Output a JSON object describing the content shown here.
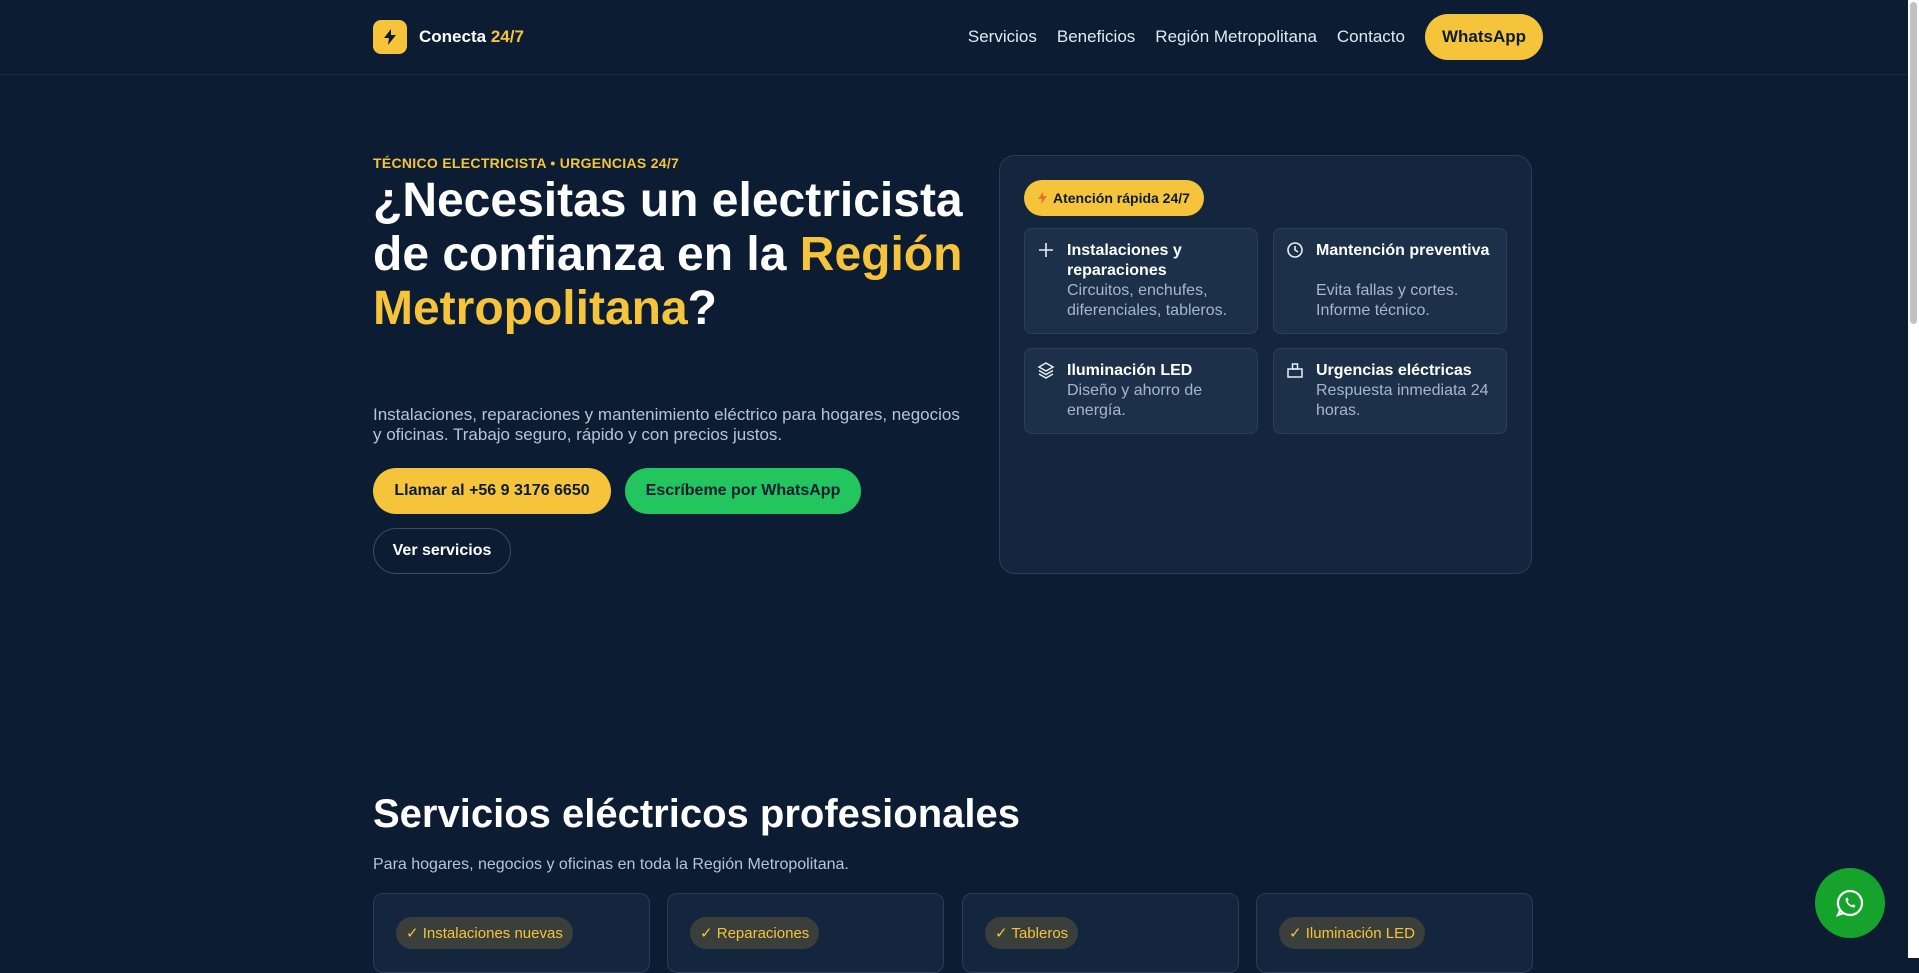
{
  "colors": {
    "background": "#0b1c33",
    "accent": "#f5c43a",
    "whatsapp": "#22c55e",
    "fab": "#16a32c"
  },
  "header": {
    "brand_name": "Conecta",
    "brand_accent": "24/7",
    "brand_icon": "lightning-bolt-icon",
    "nav": [
      "Servicios",
      "Beneficios",
      "Región Metropolitana",
      "Contacto"
    ],
    "cta": "WhatsApp"
  },
  "hero": {
    "eyebrow": "TÉCNICO ELECTRICISTA • URGENCIAS 24/7",
    "title_start": "¿Necesitas un electricista de confianza en la ",
    "title_highlight": "Región Metropolitana",
    "title_end": "?",
    "subtitle": "Instalaciones, reparaciones y mantenimiento eléctrico para hogares, negocios y oficinas. Trabajo seguro, rápido y con precios justos.",
    "buttons": {
      "call": "Llamar al +56 9 3176 6650",
      "whatsapp": "Escríbeme por WhatsApp",
      "services": "Ver servicios"
    }
  },
  "card": {
    "pill_icon": "lightning-icon",
    "pill": "Atención rápida 24/7",
    "features": [
      {
        "icon": "plus-icon",
        "title": "Instalaciones y reparaciones",
        "desc": "Circuitos, enchufes, diferenciales, tableros."
      },
      {
        "icon": "clock-icon",
        "title": "Mantención preventiva",
        "desc": "Evita fallas y cortes. Informe técnico."
      },
      {
        "icon": "layers-icon",
        "title": "Iluminación LED",
        "desc": "Diseño y ahorro de energía."
      },
      {
        "icon": "toolbox-icon",
        "title": "Urgencias eléctricas",
        "desc": "Respuesta inmediata 24 horas."
      }
    ]
  },
  "services": {
    "title": "Servicios eléctricos profesionales",
    "subtitle": "Para hogares, negocios y oficinas en toda la Región Metropolitana.",
    "tags": [
      "✓ Instalaciones nuevas",
      "✓ Reparaciones",
      "✓ Tableros",
      "✓ Iluminación LED"
    ]
  },
  "fab_icon": "whatsapp-icon"
}
